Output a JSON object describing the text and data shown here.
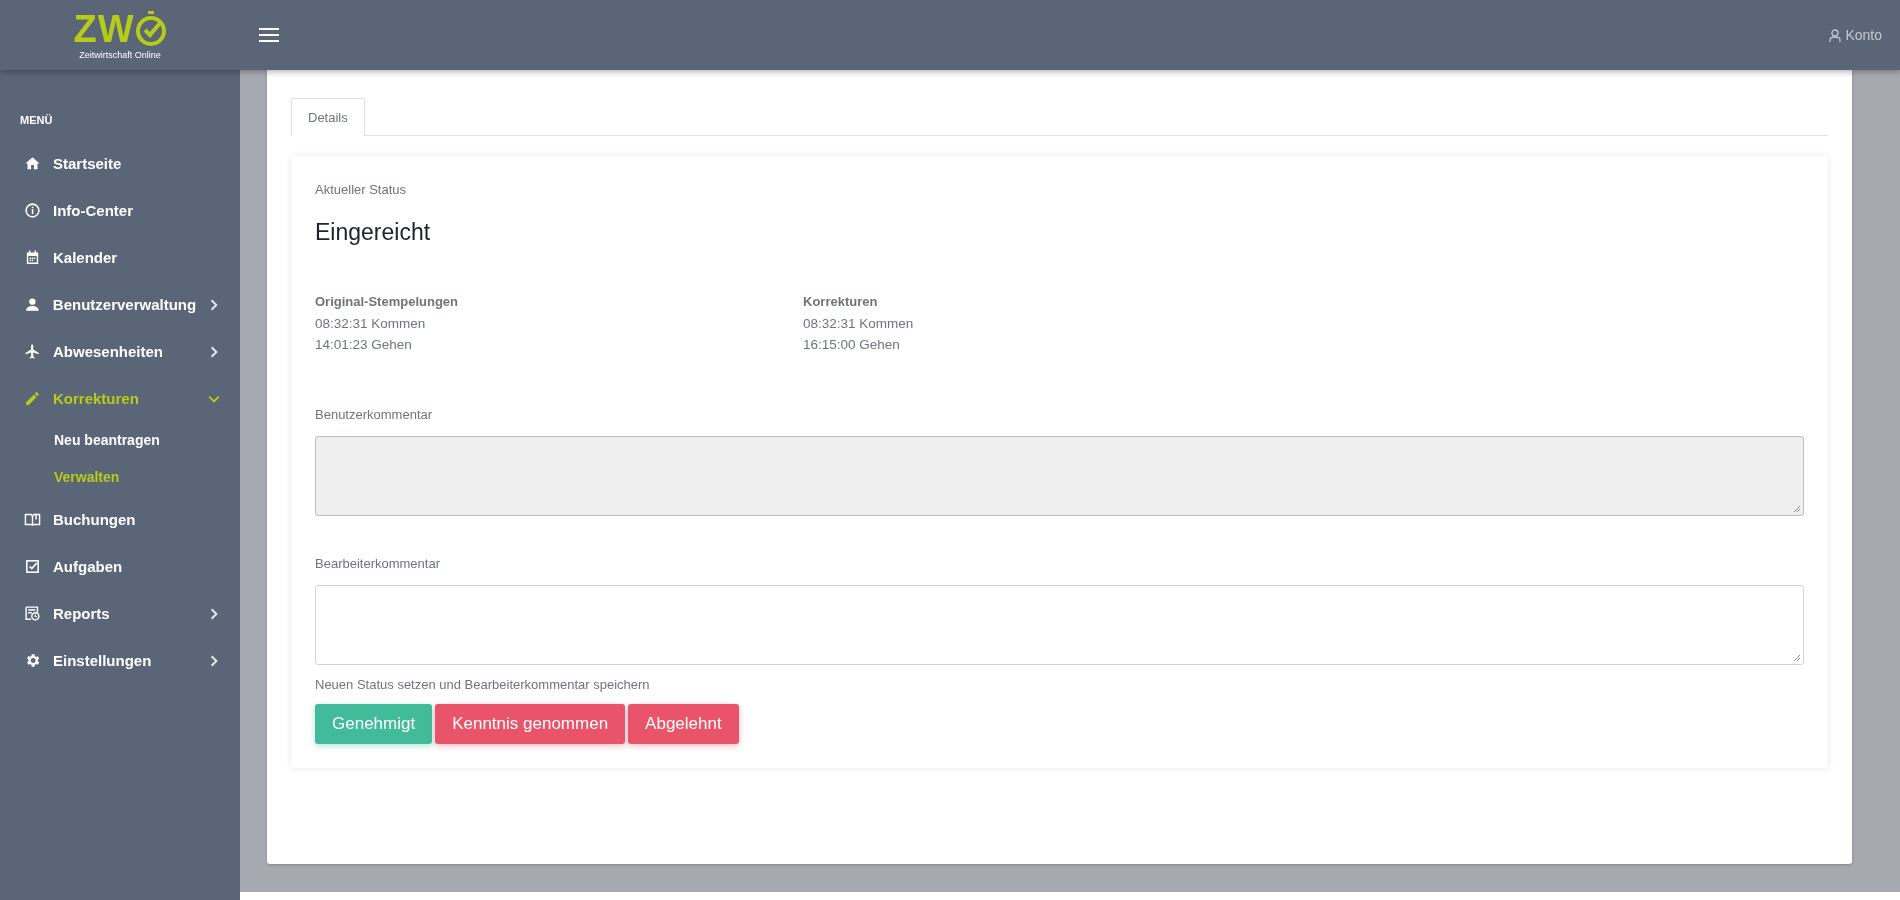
{
  "header": {
    "logo": {
      "text": "ZW",
      "tagline": "Zeitwirtschaft Online"
    },
    "account": "Konto"
  },
  "sidebar": {
    "heading": "MENÜ",
    "items": [
      {
        "label": "Startseite",
        "selected": false
      },
      {
        "label": "Info-Center",
        "selected": false
      },
      {
        "label": "Kalender",
        "selected": false
      },
      {
        "label": "Benutzerverwaltung",
        "expanded": false,
        "selected": false
      },
      {
        "label": "Abwesenheiten",
        "expanded": false,
        "selected": false
      },
      {
        "label": "Korrekturen",
        "expanded": true,
        "selected": true,
        "children": [
          {
            "label": "Neu beantragen",
            "selected": false
          },
          {
            "label": "Verwalten",
            "selected": true
          }
        ]
      },
      {
        "label": "Buchungen",
        "selected": false
      },
      {
        "label": "Aufgaben",
        "selected": false
      },
      {
        "label": "Reports",
        "expanded": false,
        "selected": false
      },
      {
        "label": "Einstellungen",
        "expanded": false,
        "selected": false
      }
    ]
  },
  "tabs": [
    {
      "label": "Details",
      "selected": true
    }
  ],
  "status": {
    "label": "Aktueller Status",
    "value": "Eingereicht"
  },
  "columns": [
    {
      "title": "Original-Stempelungen",
      "lines": [
        "08:32:31 Kommen",
        "14:01:23 Gehen"
      ]
    },
    {
      "title": "Korrekturen",
      "lines": [
        "08:32:31 Kommen",
        "16:15:00 Gehen"
      ]
    }
  ],
  "comments": [
    {
      "label": "Benutzerkommentar",
      "disabled": true
    },
    {
      "label": "Bearbeiterkommentar",
      "disabled": false
    }
  ],
  "actions": {
    "hint": "Neuen Status setzen und Bearbeiterkommentar speichern",
    "buttons": [
      {
        "label": "Genehmigt",
        "kind": "success"
      },
      {
        "label": "Kenntnis genommen",
        "kind": "danger"
      },
      {
        "label": "Abgelehnt",
        "kind": "danger"
      }
    ]
  }
}
